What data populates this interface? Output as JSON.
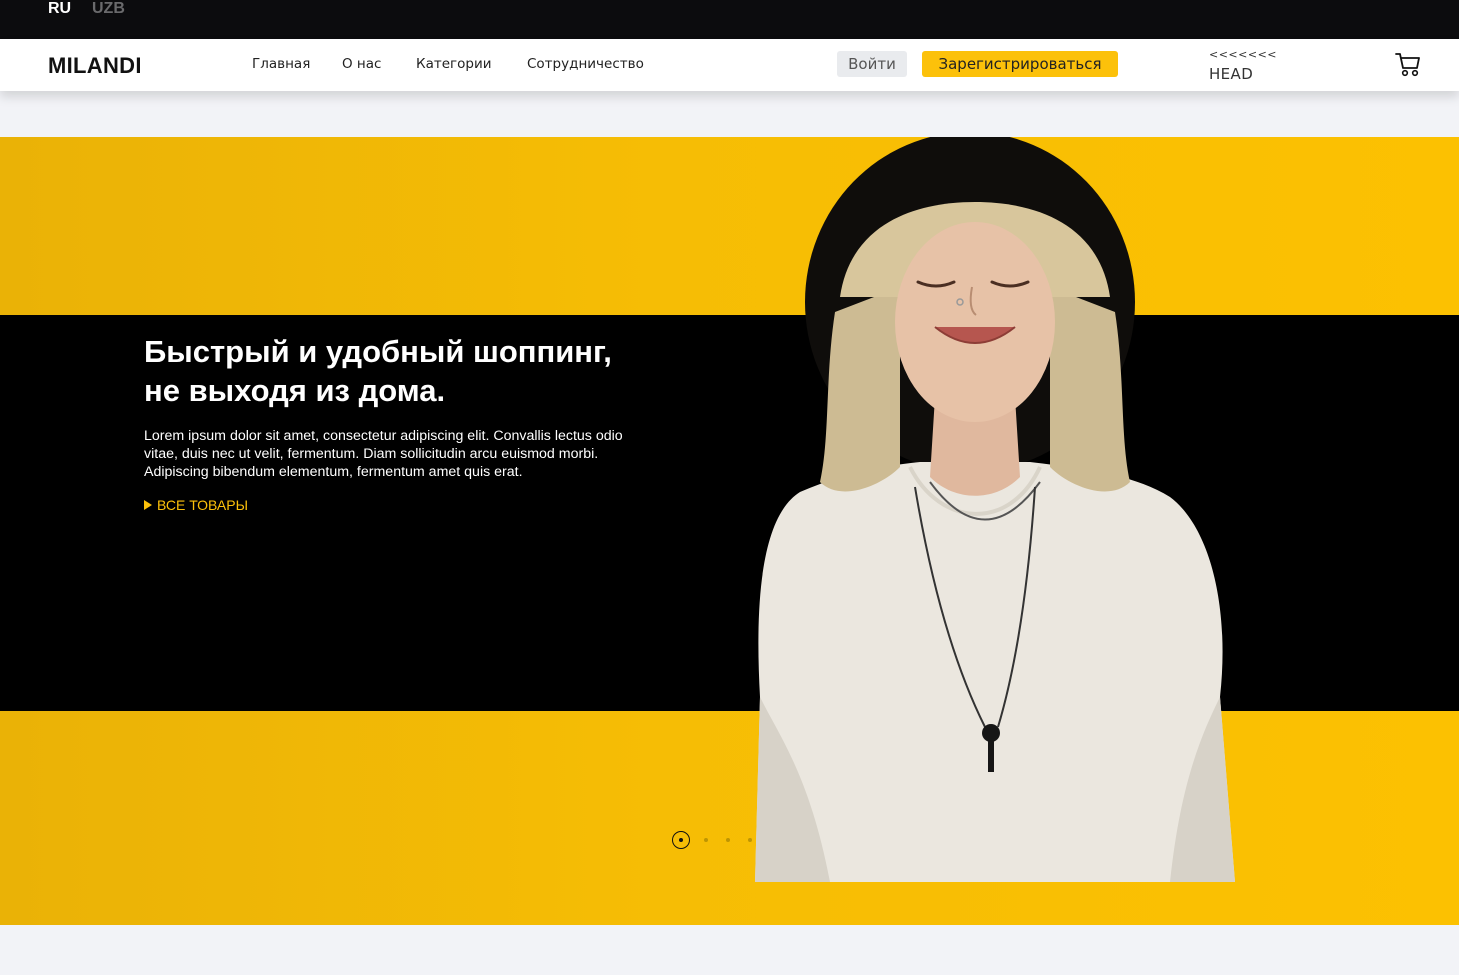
{
  "languages": [
    "RU",
    "UZB"
  ],
  "header": {
    "logo": "MILANDI",
    "nav": [
      "Главная",
      "О нас",
      "Категории",
      "Сотрудничество"
    ],
    "login_label": "Войти",
    "register_label": "Зарегистрироваться",
    "conflict_marker": "<<<<<<<",
    "head_label": "HEAD"
  },
  "hero": {
    "title_line1": "Быстрый и удобный шоппинг,",
    "title_line2": "не выходя из дома.",
    "text_line1": "Lorem ipsum dolor sit amet, consectetur adipiscing elit. Convallis lectus odio",
    "text_line2": "vitae, duis nec ut velit, fermentum. Diam sollicitudin arcu euismod morbi.",
    "text_line3": "Adipiscing bibendum elementum, fermentum amet quis erat.",
    "link_label": "ВСЕ ТОВАРЫ",
    "slides_count": 4,
    "active_slide": 1
  },
  "colors": {
    "accent": "#fcc10a",
    "topbar": "#0c0c0e",
    "hero_band": "#000000"
  },
  "icons": {
    "cart": "cart-icon",
    "link_arrow": "triangle-right-icon"
  }
}
